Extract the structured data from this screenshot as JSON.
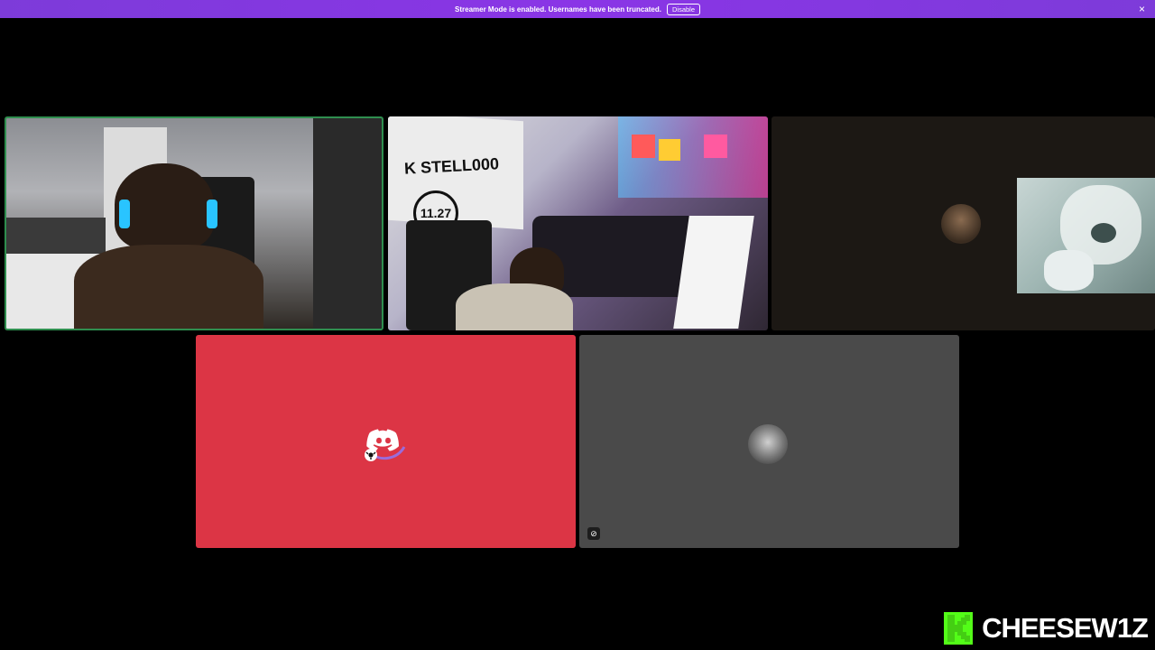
{
  "banner": {
    "message": "Streamer Mode is enabled. Usernames have been truncated.",
    "disable_label": "Disable",
    "close_icon": "×",
    "color": "#8a35e6"
  },
  "tiles": [
    {
      "kind": "video",
      "speaking": true
    },
    {
      "kind": "video",
      "sign_text": "K STELL000",
      "sign_number": "11.27"
    },
    {
      "kind": "avatar-with-pip"
    },
    {
      "kind": "avatar",
      "background": "#dc3545",
      "icon": "discord-logo-icon"
    },
    {
      "kind": "avatar",
      "background": "#4a4a4a",
      "muted_icon": "camera-off-icon"
    }
  ],
  "watermark": {
    "logo_letter": "K",
    "channel": "CHEESEW1Z",
    "brand_color": "#53fc18"
  }
}
